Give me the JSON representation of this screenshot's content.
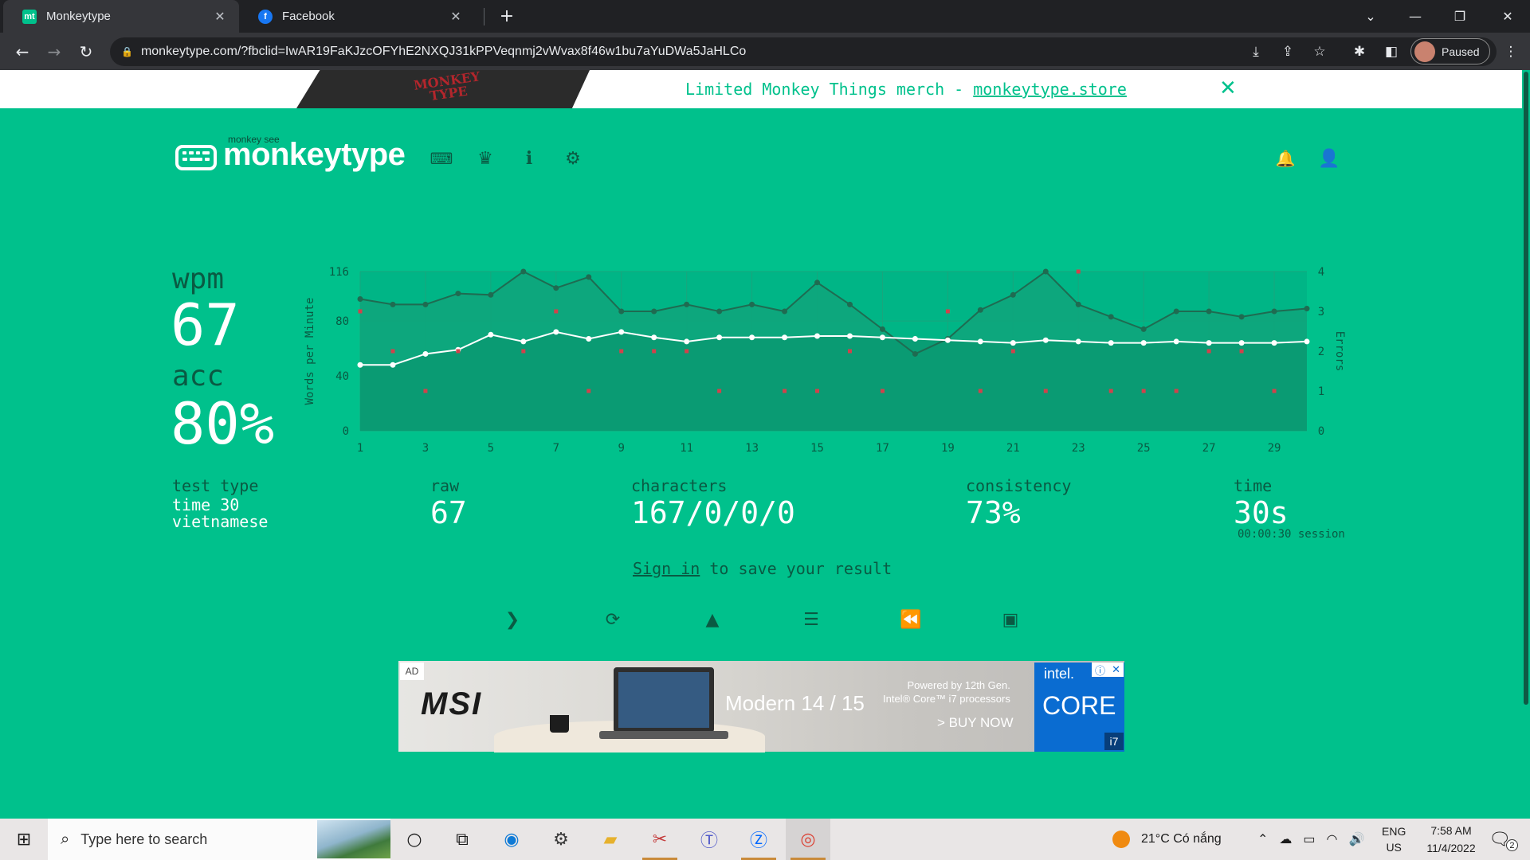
{
  "browser": {
    "tabs": [
      {
        "title": "Monkeytype",
        "favicon": "mt"
      },
      {
        "title": "Facebook",
        "favicon": "f"
      }
    ],
    "url": "monkeytype.com/?fbclid=IwAR19FaKJzcOFYhE2NXQJ31kPPVeqnmj2vWvax8f46w1bu7aYuDWa5JaHLCo",
    "profile_label": "Paused"
  },
  "banner": {
    "text": "Limited Monkey Things merch - ",
    "link": "monkeytype.store",
    "shirt_line1": "MONKEY",
    "shirt_line2": "TYPE"
  },
  "header": {
    "logo_small": "monkey see",
    "logo_text": "monkeytype"
  },
  "result": {
    "wpm_label": "wpm",
    "wpm": "67",
    "acc_label": "acc",
    "acc": "80%",
    "test_type_label": "test type",
    "test_type_line1": "time 30",
    "test_type_line2": "vietnamese",
    "raw_label": "raw",
    "raw": "67",
    "characters_label": "characters",
    "characters": "167/0/0/0",
    "consistency_label": "consistency",
    "consistency": "73%",
    "time_label": "time",
    "time": "30s",
    "session": "00:00:30 session",
    "signin_link": "Sign in",
    "signin_rest": " to save your result"
  },
  "chart_data": {
    "type": "line",
    "ylabel": "Words per Minute",
    "y2label": "Errors",
    "x": [
      1,
      2,
      3,
      4,
      5,
      6,
      7,
      8,
      9,
      10,
      11,
      12,
      13,
      14,
      15,
      16,
      17,
      18,
      19,
      20,
      21,
      22,
      23,
      24,
      25,
      26,
      27,
      28,
      29,
      30
    ],
    "xticks": [
      1,
      3,
      5,
      7,
      9,
      11,
      13,
      15,
      17,
      19,
      21,
      23,
      25,
      27,
      29
    ],
    "yticks": [
      0,
      40,
      80,
      116
    ],
    "y2ticks": [
      0,
      1,
      2,
      3,
      4
    ],
    "ylim": [
      0,
      116
    ],
    "y2lim": [
      0,
      4
    ],
    "series": [
      {
        "color": "#1f6b51",
        "values": [
          96,
          92,
          92,
          100,
          99,
          116,
          104,
          112,
          87,
          87,
          92,
          87,
          92,
          87,
          108,
          92,
          74,
          56,
          67,
          88,
          99,
          116,
          92,
          83,
          74,
          87,
          87,
          83,
          87,
          89
        ]
      },
      {
        "color": "#ffffff",
        "values": [
          48,
          48,
          56,
          59,
          70,
          65,
          72,
          67,
          72,
          68,
          65,
          68,
          68,
          68,
          69,
          69,
          68,
          67,
          66,
          65,
          64,
          66,
          65,
          64,
          64,
          65,
          64,
          64,
          64,
          65
        ]
      },
      {
        "color": "#d1424b",
        "values": [
          3,
          2,
          1,
          2,
          null,
          2,
          3,
          1,
          2,
          2,
          2,
          1,
          null,
          1,
          1,
          2,
          1,
          null,
          3,
          1,
          2,
          1,
          4,
          1,
          1,
          1,
          2,
          2,
          1,
          null
        ]
      }
    ]
  },
  "ad": {
    "tag": "AD",
    "brand": "MSI",
    "model": "Modern 14 / 15",
    "powered_line1": "Powered by 12th Gen.",
    "powered_line2": "Intel® Core™ i7 processors",
    "cta": "> BUY NOW",
    "intel": "intel.",
    "core": "CORE",
    "i7": "i7"
  },
  "taskbar": {
    "search_placeholder": "Type here to search",
    "weather": "21°C  Có nắng",
    "lang_line1": "ENG",
    "lang_line2": "US",
    "time": "7:58 AM",
    "date": "11/4/2022",
    "notifications": "2"
  }
}
